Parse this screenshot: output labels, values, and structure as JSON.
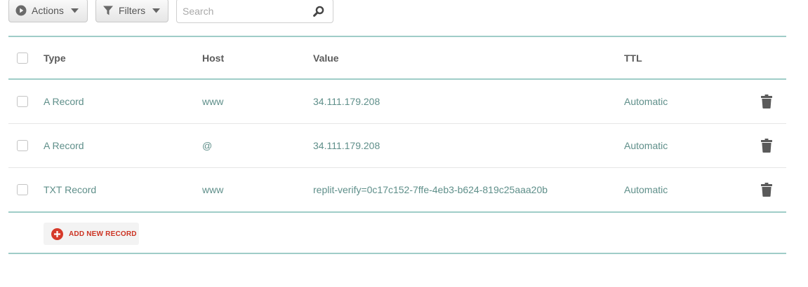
{
  "toolbar": {
    "actions_label": "Actions",
    "filters_label": "Filters",
    "search_placeholder": "Search"
  },
  "table": {
    "columns": [
      "Type",
      "Host",
      "Value",
      "TTL"
    ],
    "rows": [
      {
        "type": "A Record",
        "host": "www",
        "value": "34.111.179.208",
        "ttl": "Automatic"
      },
      {
        "type": "A Record",
        "host": "@",
        "value": "34.111.179.208",
        "ttl": "Automatic"
      },
      {
        "type": "TXT Record",
        "host": "www",
        "value": "replit-verify=0c17c152-7ffe-4eb3-b624-819c25aaa20b",
        "ttl": "Automatic"
      }
    ],
    "add_label": "ADD NEW RECORD"
  },
  "colors": {
    "teal_rule": "#9fcdc8",
    "cell_text": "#5f8f8a",
    "add_red": "#cc3322"
  },
  "icons": {
    "actions": "play-circle-icon",
    "filters": "funnel-icon",
    "search": "search-icon",
    "delete": "trash-icon",
    "add": "plus-circle-icon"
  }
}
